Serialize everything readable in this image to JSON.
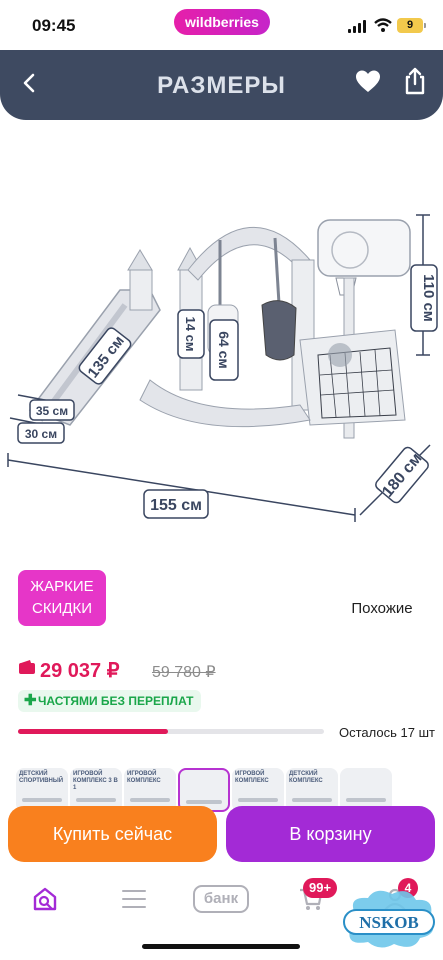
{
  "status_bar": {
    "time": "09:45",
    "app_pill": "wildberries",
    "battery": "9"
  },
  "header": {
    "title": "РАЗМЕРЫ",
    "back_icon": "chevron-left-icon",
    "like_icon": "heart-icon",
    "share_icon": "share-icon"
  },
  "product_image": {
    "dimensions": {
      "height": "110 см",
      "width": "155 см",
      "depth": "180 см",
      "slide_length": "135 см",
      "swing_height": "64 см",
      "seat_height": "14 см",
      "step_upper": "35 см",
      "step_lower": "30 см"
    },
    "promo_badge": [
      "ЖАРКИЕ",
      "СКИДКИ"
    ],
    "similar_button": "Похожие"
  },
  "price": {
    "current": "29 037 ₽",
    "old": "59 780 ₽",
    "installments": "ЧАСТЯМИ БЕЗ ПЕРЕПЛАТ",
    "stock_text": "Осталось 17 шт",
    "stock_fraction": 0.49
  },
  "thumbnails": [
    {
      "caption": "ДЕТСКИЙ СПОРТИВНЫЙ"
    },
    {
      "caption": "ИГРОВОЙ КОМПЛЕКС 3 В 1"
    },
    {
      "caption": "ИГРОВОЙ КОМПЛЕКС"
    },
    {
      "caption": ""
    },
    {
      "caption": "ИГРОВОЙ КОМПЛЕКС"
    },
    {
      "caption": "ДЕТСКИЙ КОМПЛЕКС"
    },
    {
      "caption": ""
    }
  ],
  "actions": {
    "buy_now": "Купить сейчас",
    "add_to_cart": "В корзину"
  },
  "bottom_nav": {
    "bank": "банк",
    "cart_badge": "99+",
    "profile_badge": "4"
  },
  "watermark": "NSKOB",
  "colors": {
    "header": "#3e4a61",
    "price": "#e0195a",
    "buy_now": "#f9801e",
    "cart": "#a32ad6",
    "promo": "#e636c8"
  }
}
